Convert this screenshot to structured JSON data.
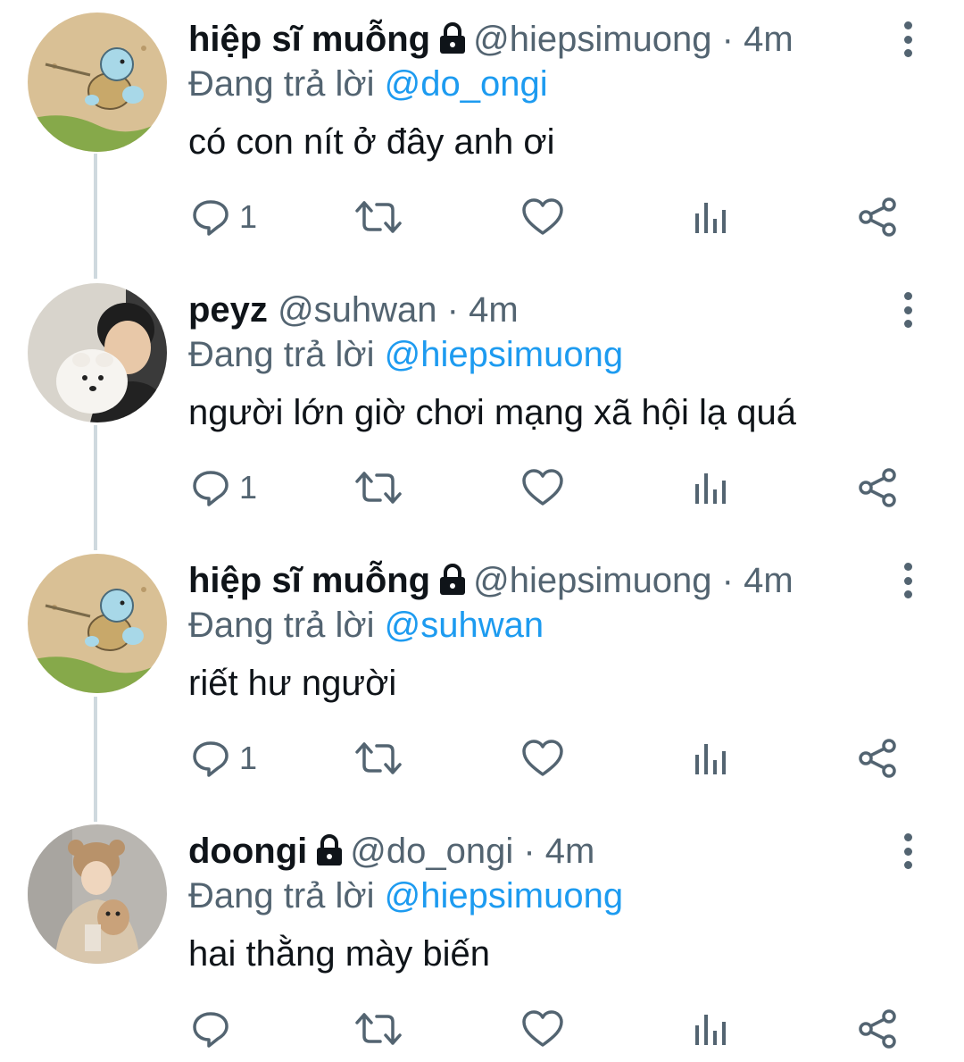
{
  "colors": {
    "text_primary": "#0f1419",
    "text_secondary": "#536471",
    "link_accent": "#1d9bf0",
    "thread_line": "#cfd9de"
  },
  "tweets": [
    {
      "display_name": "hiệp sĩ muỗng",
      "protected": true,
      "handle": "@hiepsimuong",
      "time": "· 4m",
      "reply_prefix": "Đang trả lời",
      "reply_to": "@do_ongi",
      "text": "có con nít ở đây anh ơi",
      "reply_count": "1",
      "avatar_icon": "turtle-cartoon-avatar"
    },
    {
      "display_name": "peyz",
      "protected": false,
      "handle": "@suhwan",
      "time": "· 4m",
      "reply_prefix": "Đang trả lời",
      "reply_to": "@hiepsimuong",
      "text": "người lớn giờ chơi mạng xã hội lạ quá",
      "reply_count": "1",
      "avatar_icon": "person-with-dog-avatar"
    },
    {
      "display_name": "hiệp sĩ muỗng",
      "protected": true,
      "handle": "@hiepsimuong",
      "time": "· 4m",
      "reply_prefix": "Đang trả lời",
      "reply_to": "@suhwan",
      "text": "riết hư người",
      "reply_count": "1",
      "avatar_icon": "turtle-cartoon-avatar"
    },
    {
      "display_name": "doongi",
      "protected": true,
      "handle": "@do_ongi",
      "time": "· 4m",
      "reply_prefix": "Đang trả lời",
      "reply_to": "@hiepsimuong",
      "text": "hai thằng mày biến",
      "reply_count": "",
      "avatar_icon": "person-in-bear-hat-avatar"
    }
  ]
}
